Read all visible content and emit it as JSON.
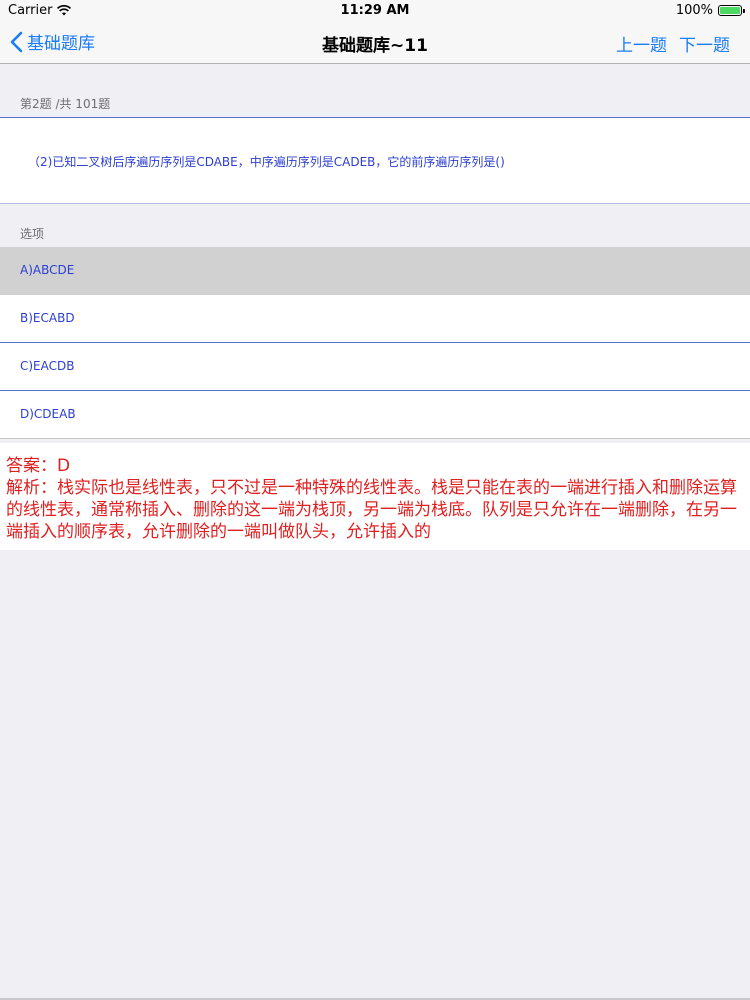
{
  "status_bar": {
    "carrier": "Carrier",
    "time": "11:29 AM",
    "battery_text": "100%",
    "battery_level": 1.0,
    "battery_color": "#4cd964"
  },
  "nav": {
    "back_label": "基础题库",
    "title": "基础题库~11",
    "prev_label": "上一题",
    "next_label": "下一题",
    "accent_color": "#1a7cf6"
  },
  "question": {
    "counter": "第2题 /共 101题",
    "text": "（2)已知二叉树后序遍历序列是CDABE，中序遍历序列是CADEB，它的前序遍历序列是()"
  },
  "options_label": "选项",
  "options": [
    {
      "label": "A)ABCDE",
      "selected": true
    },
    {
      "label": "B)ECABD",
      "selected": false
    },
    {
      "label": "C)EACDB",
      "selected": false
    },
    {
      "label": "D)CDEAB",
      "selected": false
    }
  ],
  "answer": {
    "answer_line": "答案：D",
    "analysis_line": "解析：栈实际也是线性表，只不过是一种特殊的线性表。栈是只能在表的一端进行插入和删除运算的线性表，通常称插入、删除的这一端为栈顶，另一端为栈底。队列是只允许在一端删除，在另一端插入的顺序表，允许删除的一端叫做队头，允许插入的",
    "text_color": "#e02020"
  }
}
